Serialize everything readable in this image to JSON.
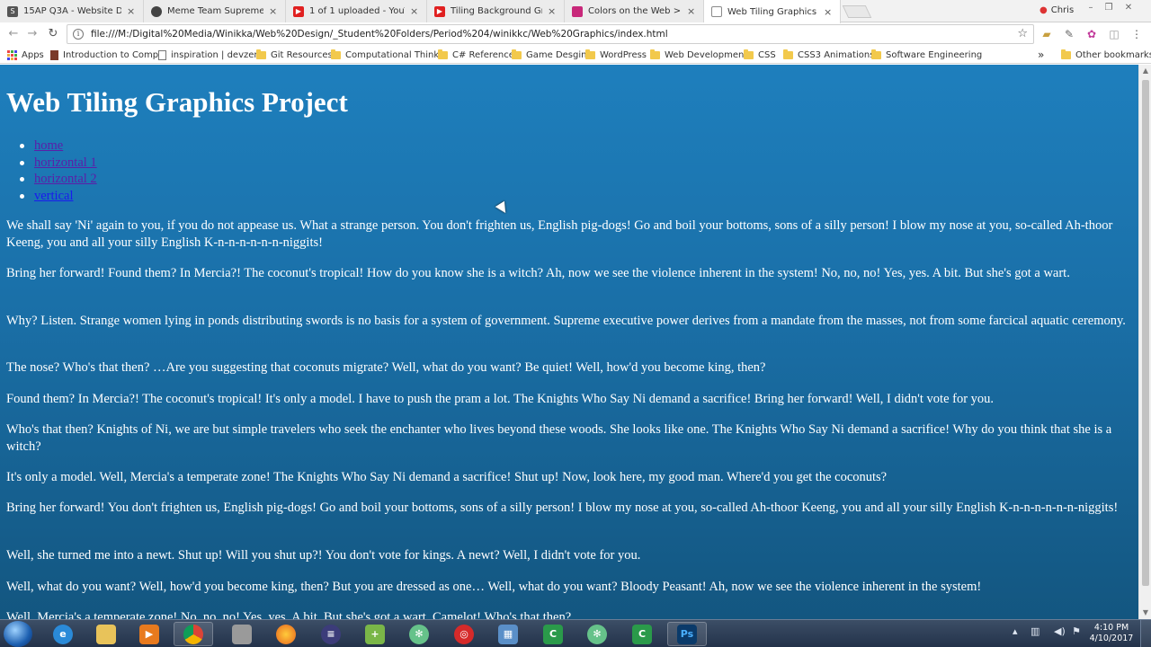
{
  "browser": {
    "tabs": [
      {
        "title": "15AP Q3A - Website Desi",
        "icon": "google-sites-icon",
        "color": "#555555",
        "active": false
      },
      {
        "title": "Meme Team Supreme - ",
        "icon": "github-icon",
        "color": "#444444",
        "active": false
      },
      {
        "title": "1 of 1 uploaded - YouTu",
        "icon": "youtube-icon",
        "color": "#e02020",
        "active": false
      },
      {
        "title": "Tiling Background Graph",
        "icon": "youtube-icon",
        "color": "#e02020",
        "active": false
      },
      {
        "title": "Colors on the Web > Col",
        "icon": "colors-site-icon",
        "color": "#c8287a",
        "active": false
      },
      {
        "title": "Web Tiling Graphics Proj",
        "icon": "page-icon",
        "color": "#8a8a8a",
        "active": true
      }
    ],
    "close_glyph": "×",
    "profile_name": "Chris",
    "address": {
      "url": "file:///M:/Digital%20Media/Winikka/Web%20Design/_Student%20Folders/Period%204/winikkc/Web%20Graphics/index.html"
    },
    "bookmarks": [
      {
        "label": "Apps",
        "icon": "apps-grid-icon"
      },
      {
        "label": "Introduction to Comp",
        "icon": "site-favicon-icon"
      },
      {
        "label": "inspiration | devzen",
        "icon": "doc-icon"
      },
      {
        "label": "Git Resources",
        "icon": "folder-icon"
      },
      {
        "label": "Computational Thinki",
        "icon": "folder-icon"
      },
      {
        "label": "C# Reference",
        "icon": "folder-icon"
      },
      {
        "label": "Game Desgin",
        "icon": "folder-icon"
      },
      {
        "label": "WordPress",
        "icon": "folder-icon"
      },
      {
        "label": "Web Development",
        "icon": "folder-icon"
      },
      {
        "label": "CSS",
        "icon": "folder-icon"
      },
      {
        "label": "CSS3 Animations",
        "icon": "folder-icon"
      },
      {
        "label": "Software Engineering",
        "icon": "folder-icon"
      }
    ],
    "bookmarks_overflow": "»",
    "other_bookmarks": "Other bookmarks"
  },
  "page": {
    "title": "Web Tiling Graphics Project",
    "nav": [
      {
        "label": "home",
        "visited": true
      },
      {
        "label": "horizontal 1",
        "visited": true
      },
      {
        "label": "horizontal 2",
        "visited": true
      },
      {
        "label": "vertical",
        "visited": false
      }
    ],
    "paragraphs": [
      "We shall say 'Ni' again to you, if you do not appease us. What a strange person. You don't frighten us, English pig-dogs! Go and boil your bottoms, sons of a silly person! I blow my nose at you, so-called Ah-thoor Keeng, you and all your silly English K-n-n-n-n-n-n-niggits!",
      "Bring her forward! Found them? In Mercia?! The coconut's tropical! How do you know she is a witch? Ah, now we see the violence inherent in the system! No, no, no! Yes, yes. A bit. But she's got a wart.",
      "Why? Listen. Strange women lying in ponds distributing swords is no basis for a system of government. Supreme executive power derives from a mandate from the masses, not from some farcical aquatic ceremony.",
      "The nose? Who's that then? …Are you suggesting that coconuts migrate? Well, what do you want? Be quiet! Well, how'd you become king, then?",
      "Found them? In Mercia?! The coconut's tropical! It's only a model. I have to push the pram a lot. The Knights Who Say Ni demand a sacrifice! Bring her forward! Well, I didn't vote for you.",
      "Who's that then? Knights of Ni, we are but simple travelers who seek the enchanter who lives beyond these woods. She looks like one. The Knights Who Say Ni demand a sacrifice! Why do you think that she is a witch?",
      "It's only a model. Well, Mercia's a temperate zone! The Knights Who Say Ni demand a sacrifice! Shut up! Now, look here, my good man. Where'd you get the coconuts?",
      "Bring her forward! You don't frighten us, English pig-dogs! Go and boil your bottoms, sons of a silly person! I blow my nose at you, so-called Ah-thoor Keeng, you and all your silly English K-n-n-n-n-n-n-niggits!",
      "Well, she turned me into a newt. Shut up! Will you shut up?! You don't vote for kings. A newt? Well, I didn't vote for you.",
      "Well, what do you want? Well, how'd you become king, then? But you are dressed as one… Well, what do you want? Bloody Peasant! Ah, now we see the violence inherent in the system!",
      "Well, Mercia's a temperate zone! No, no, no! Yes, yes. A bit. But she's got a wart. Camelot! Who's that then?"
    ],
    "background_top": "#1e7fbd",
    "background_bottom": "#135680"
  },
  "taskbar": {
    "items": [
      {
        "icon": "internet-explorer-icon",
        "color": "#2a8ad8",
        "open": false
      },
      {
        "icon": "file-explorer-icon",
        "color": "#e8c35a",
        "open": false
      },
      {
        "icon": "media-player-icon",
        "color": "#e87a1e",
        "open": false
      },
      {
        "icon": "chrome-icon",
        "color": "#3aa757",
        "open": true
      },
      {
        "icon": "network-tool-icon",
        "color": "#9a9a9a",
        "open": false
      },
      {
        "icon": "firefox-icon",
        "color": "#e8641e",
        "open": false
      },
      {
        "icon": "eclipse-icon",
        "color": "#3c3c7a",
        "open": false
      },
      {
        "icon": "notepad-plus-icon",
        "color": "#7ab648",
        "open": false
      },
      {
        "icon": "atom-icon",
        "color": "#66c28a",
        "open": false
      },
      {
        "icon": "adobe-reader-icon",
        "color": "#d62a2a",
        "open": false
      },
      {
        "icon": "image-viewer-icon",
        "color": "#5a8fc8",
        "open": false
      },
      {
        "icon": "camtasia-icon",
        "color": "#2a9a4a",
        "open": false
      },
      {
        "icon": "atom-icon",
        "color": "#66c28a",
        "open": false
      },
      {
        "icon": "camtasia-recorder-icon",
        "color": "#2a9a4a",
        "open": false
      },
      {
        "icon": "photoshop-icon",
        "color": "#0a3a6a",
        "open": true
      }
    ],
    "photoshop_label": "Ps",
    "time": "4:10 PM",
    "date": "4/10/2017"
  }
}
